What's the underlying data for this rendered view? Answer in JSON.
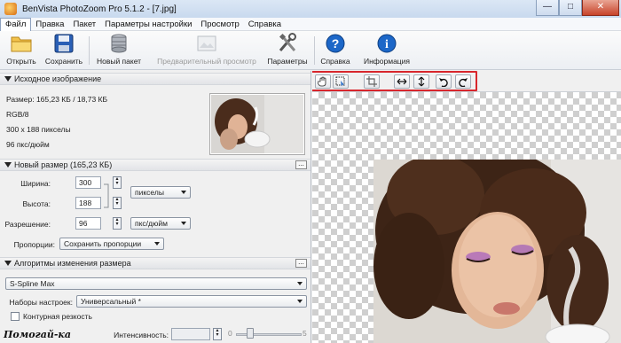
{
  "window": {
    "title": "BenVista PhotoZoom Pro 5.1.2 - [7.jpg]",
    "minimize": "—",
    "maximize": "□",
    "close": "✕"
  },
  "menu": [
    "Файл",
    "Правка",
    "Пакет",
    "Параметры настройки",
    "Просмотр",
    "Справка"
  ],
  "toolbar": {
    "open": "Открыть",
    "save": "Сохранить",
    "new_batch": "Новый пакет",
    "preview": "Предварительный просмотр",
    "settings": "Параметры",
    "help": "Справка",
    "info": "Информация"
  },
  "source": {
    "header": "Исходное изображение",
    "size": "Размер: 165,23 КБ / 18,73 КБ",
    "mode": "RGB/8",
    "dimensions": "300 x 188 пикселы",
    "dpi": "96 пкс/дюйм"
  },
  "new_size": {
    "header": "Новый размер (165,23 КБ)",
    "dots": "...",
    "width_label": "Ширина:",
    "width_value": "300",
    "height_label": "Высота:",
    "height_value": "188",
    "units": "пикселы",
    "resolution_label": "Разрешение:",
    "resolution_value": "96",
    "resolution_units": "пкс/дюйм",
    "proportions_label": "Пропорции:",
    "proportions_value": "Сохранить пропорции"
  },
  "algorithms": {
    "header": "Алгоритмы изменения размера",
    "dots": "...",
    "method": "S-Spline Max",
    "presets_label": "Наборы настроек:",
    "presets_value": "Универсальный *",
    "sharpness_label": "Контурная резкость",
    "sharpness_checked": false,
    "intensity_label": "Интенсивность:",
    "slider_min": "0",
    "slider_max": "5"
  },
  "watermark": "Помогай-ка",
  "icons": {
    "open": "folder-icon",
    "save": "floppy-disk-icon",
    "new_batch": "database-stack-icon",
    "preview": "preview-image-icon",
    "settings": "tools-icon",
    "help": "question-icon",
    "info": "info-icon",
    "hand": "hand-icon",
    "select": "marquee-select-icon",
    "crop": "crop-icon",
    "fit_width": "fit-width-icon",
    "fit_height": "fit-height-icon",
    "rotate_left": "rotate-left-icon",
    "rotate_right": "rotate-right-icon"
  },
  "colors": {
    "highlight": "#d8262c",
    "help_blue": "#1c67c8"
  }
}
